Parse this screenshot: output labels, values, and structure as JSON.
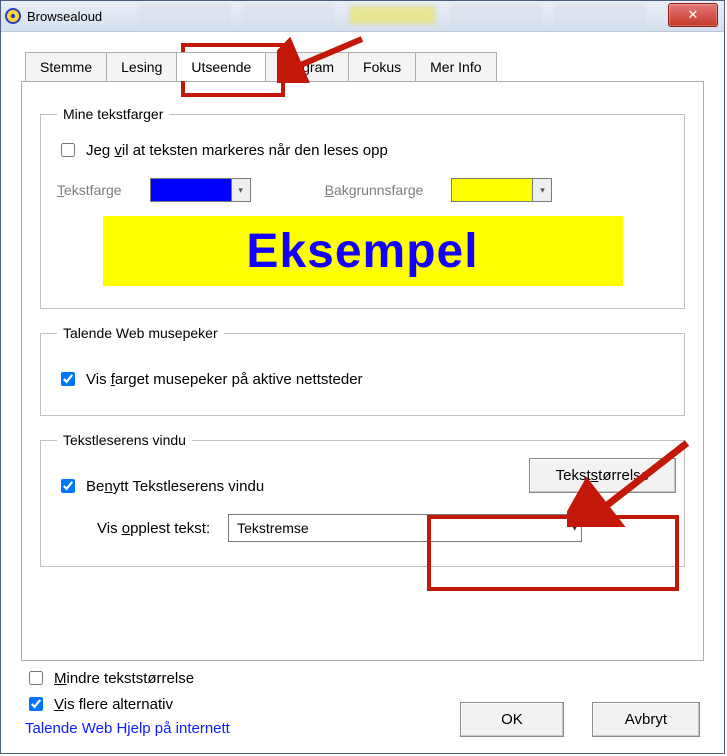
{
  "window": {
    "title": "Browsealoud",
    "close_icon": "✕"
  },
  "tabs": {
    "stemme": "Stemme",
    "lesing": "Lesing",
    "utseende": "Utseende",
    "program": "Program",
    "fokus": "Fokus",
    "merinfo": "Mer Info",
    "active": "utseende"
  },
  "colors_fs": {
    "legend": "Mine tekstfarger",
    "highlight_label_pre": "Jeg ",
    "highlight_label_u": "v",
    "highlight_label_post": "il at teksten markeres når den leses opp",
    "highlight_checked": false,
    "text_color_pre": "",
    "text_color_u": "T",
    "text_color_post": "ekstfarge",
    "text_color_value": "#0000ff",
    "bg_color_pre": "",
    "bg_color_u": "B",
    "bg_color_post": "akgrunnsfarge",
    "bg_color_value": "#ffff00",
    "example_text": "Eksempel"
  },
  "pointer_fs": {
    "legend": "Talende Web musepeker",
    "label_pre": "Vis ",
    "label_u": "f",
    "label_post": "arget musepeker på aktive nettsteder",
    "checked": true
  },
  "reader_fs": {
    "legend": "Tekstleserens vindu",
    "use_label_pre": "Be",
    "use_label_u": "n",
    "use_label_post": "ytt Tekstleserens vindu",
    "use_checked": true,
    "size_btn_pre": "Tekst",
    "size_btn_u": "s",
    "size_btn_post": "tørrelse",
    "show_label_pre": "Vis ",
    "show_label_u": "o",
    "show_label_post": "pplest tekst:",
    "select_value": "Tekstremse"
  },
  "footer": {
    "smaller_pre": "",
    "smaller_u": "M",
    "smaller_post": "indre tekststørrelse",
    "smaller_checked": false,
    "more_pre": "",
    "more_u": "V",
    "more_post": "is flere alternativ",
    "more_checked": true,
    "help_link": "Talende Web Hjelp på internett",
    "ok": "OK",
    "cancel": "Avbryt"
  }
}
